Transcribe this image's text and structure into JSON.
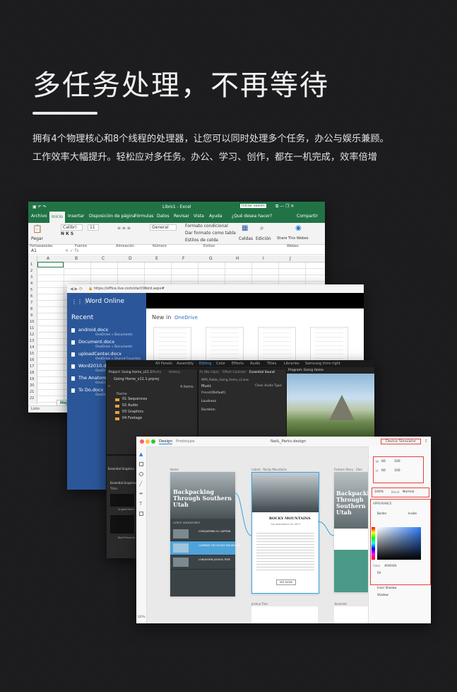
{
  "hero": {
    "title": "多任务处理，不再等待",
    "desc_line1": "拥有4个物理核心和8个线程的处理器，让您可以同时处理多个任务，办公与娱乐兼顾。",
    "desc_line2": "工作效率大幅提升。轻松应对多任务。办公、学习、创作，都在一机完成，效率倍增"
  },
  "excel": {
    "window_title": "Libro1 - Excel",
    "signin": "Iniciar sesión",
    "tabs": [
      "Archivo",
      "Inicio",
      "Insertar",
      "Disposición de página",
      "Fórmulas",
      "Datos",
      "Revisar",
      "Vista",
      "Ayuda"
    ],
    "tell_me": "¿Qué desea hacer?",
    "share": "Compartir",
    "font_name": "Calibri",
    "font_size": "11",
    "number_format": "General",
    "cond_format": "Formato condicional",
    "table_format": "Dar formato como tabla",
    "cell_styles": "Estilos de celda",
    "cells": "Celdas",
    "editing": "Edición",
    "share_webex": "Share This Webex",
    "paste": "Pegar",
    "groups": [
      "Portapapeles",
      "Fuente",
      "Alineación",
      "Número",
      "Estilos",
      "Webex"
    ],
    "name_box": "A1",
    "columns": [
      "A",
      "B",
      "C",
      "D",
      "E",
      "F",
      "G",
      "H",
      "I",
      "J"
    ],
    "rows": [
      "1",
      "2",
      "3",
      "4",
      "5",
      "6",
      "7",
      "8",
      "9",
      "10",
      "11",
      "12",
      "13",
      "14",
      "15",
      "16",
      "17",
      "18",
      "19",
      "20",
      "21",
      "22"
    ],
    "sheet_tab": "Hoja",
    "status": "Listo"
  },
  "word": {
    "url": "https://office.live.com/start/Word.aspx#",
    "app_name": "Word Online",
    "recent_label": "Recent",
    "new_in": "New in",
    "onedrive": "OneDrive",
    "recent": [
      {
        "name": "android.docx",
        "loc": "OneDrive » Documents"
      },
      {
        "name": "Document.docx",
        "loc": "OneDrive » Documents"
      },
      {
        "name": "uploadCenter.docx",
        "loc": "OneDrive » Shared Favorites"
      },
      {
        "name": "Word2010.docx",
        "loc": "OneDrive"
      },
      {
        "name": "The Anatomy",
        "loc": "OneDrive"
      },
      {
        "name": "To Do.docx",
        "loc": "OneDrive"
      }
    ]
  },
  "premiere": {
    "workspace_tabs": [
      "All Panels",
      "Assembly",
      "Editing",
      "Color",
      "Effects",
      "Audio",
      "Titles",
      "Libraries",
      "Samsung Intro right"
    ],
    "active_tab": "Editing",
    "project_tabs": [
      "Project: Going Home_v11.1",
      "Effects",
      "History"
    ],
    "project_file": "Going Home_v11.1.prproj",
    "item_count": "4 Items",
    "name_col": "Name",
    "folders": [
      "01 Sequences",
      "02 Audio",
      "03 Graphics",
      "04 Footage"
    ],
    "center_tabs": [
      "fx (No clips)",
      "Effect Controls",
      "Essential Sound"
    ],
    "clip_name": "NPM_Rebbe_Going_Home_v2.wav",
    "music": "Music",
    "clear_audio": "Clear Audio Type",
    "preset_label": "Preset",
    "preset_value": "(Default)",
    "loudness": "Loudness",
    "duration": "Duration",
    "program": "Program: Going Home",
    "essential_graphics": "Essential Graphics",
    "titles_label": "Titles",
    "angled_name": "Angled Name",
    "bold_name": "Bold Presente"
  },
  "xd": {
    "tabs": [
      "Design",
      "Prototype"
    ],
    "file_name": "NatL_Parks.design",
    "device_preview": "Device Simulator",
    "artboards": [
      {
        "label": "Home",
        "hero": "Backpacking Through Southern Utah"
      },
      {
        "label": "Latest - Rocky Mountains",
        "hero": "ROCKY MOUNTAINS",
        "sub": "Top destination for 2017"
      },
      {
        "label": "Feature Story - Zion",
        "hero": "Backpacking Through Southern Utah"
      }
    ],
    "list_items": [
      "CONQUERING EL CAPITAN",
      "CAMPING THE ROCKY MOUNTAINS",
      "LONGHORN JOSHUA TREE"
    ],
    "latest_label": "LATEST ADVENTURES",
    "see_more": "SEE MORE",
    "bottom_labels": [
      "Joshua Tree",
      "Yosemite"
    ],
    "zoom": "100%",
    "w_label": "W",
    "w_value": "60",
    "h_label": "H",
    "h_value": "60",
    "x_value": "100",
    "y_value": "100",
    "opacity": "100%",
    "blend_label": "Blend",
    "blend_mode": "Normal",
    "appearance": "APPEARANCE",
    "border": "Border",
    "inside": "Inside",
    "hex_label": "Color",
    "hex": "#FAFAFA",
    "fill": "Fill",
    "inner_shadow": "Inner Shadow",
    "shadow": "Shadow"
  }
}
